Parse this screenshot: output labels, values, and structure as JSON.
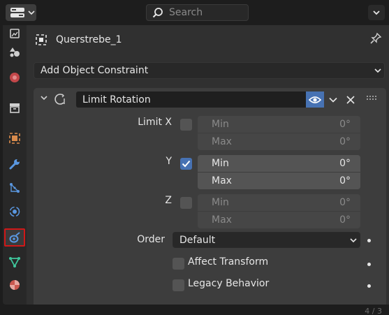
{
  "header": {
    "search_placeholder": "Search",
    "editor_icon": "properties-editor-icon"
  },
  "tabs": [
    {
      "name": "render-icon",
      "active": false
    },
    {
      "name": "scene-props-icon",
      "active": false
    },
    {
      "name": "world-icon",
      "active": false
    },
    {
      "name": "collection-icon",
      "active": false
    },
    {
      "name": "object-icon",
      "active": false
    },
    {
      "name": "modifier-wrench-icon",
      "active": false
    },
    {
      "name": "particles-icon",
      "active": false
    },
    {
      "name": "physics-icon",
      "active": false
    },
    {
      "name": "object-constraint-icon",
      "active": true
    },
    {
      "name": "object-data-icon",
      "active": false
    },
    {
      "name": "material-icon",
      "active": false
    }
  ],
  "object": {
    "name": "Querstrebe_1"
  },
  "add_constraint": {
    "label": "Add Object Constraint"
  },
  "constraint": {
    "name": "Limit Rotation",
    "limit_x": {
      "label": "Limit X",
      "checked": false,
      "min_label": "Min",
      "min_value": "0°",
      "max_label": "Max",
      "max_value": "0°"
    },
    "limit_y": {
      "label": "Y",
      "checked": true,
      "min_label": "Min",
      "min_value": "0°",
      "max_label": "Max",
      "max_value": "0°"
    },
    "limit_z": {
      "label": "Z",
      "checked": false,
      "min_label": "Min",
      "min_value": "0°",
      "max_label": "Max",
      "max_value": "0°"
    },
    "order": {
      "label": "Order",
      "value": "Default"
    },
    "affect_transform": {
      "label": "Affect Transform",
      "checked": false
    },
    "legacy_behavior": {
      "label": "Legacy Behavior",
      "checked": false
    }
  },
  "colors": {
    "accent": "#4772b3",
    "highlight": "#d01818"
  },
  "footer": {
    "corner_text": "4 / 3"
  }
}
